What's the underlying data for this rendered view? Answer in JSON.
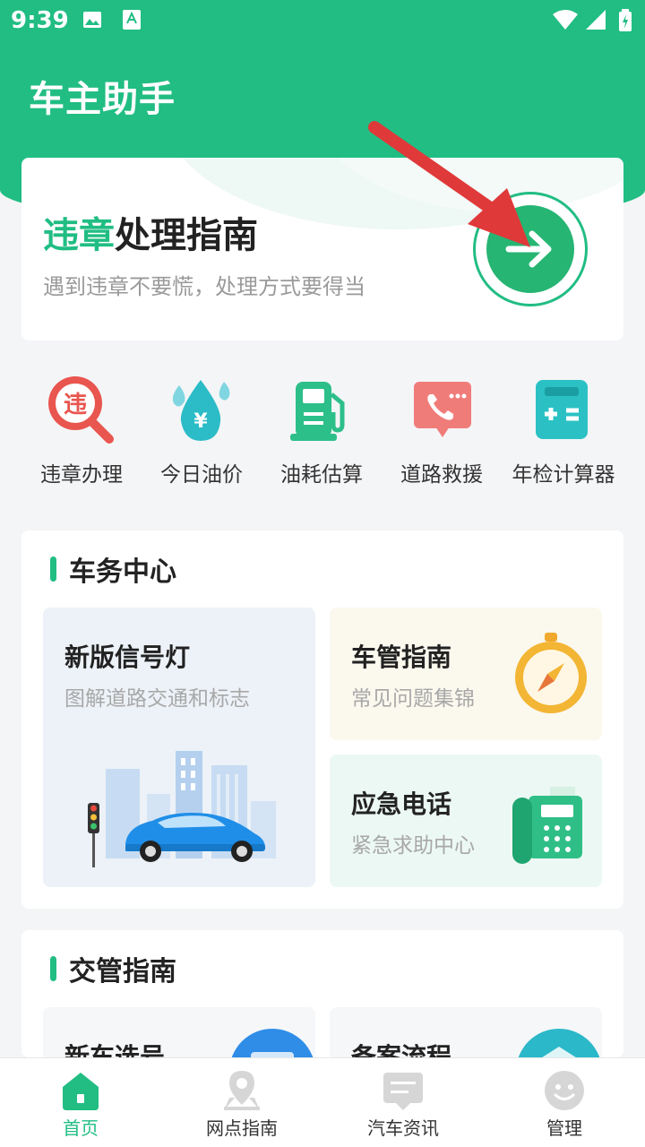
{
  "status_bar": {
    "time": "9:39"
  },
  "app": {
    "title": "车主助手"
  },
  "hero": {
    "title_accent": "违章",
    "title_rest": "处理指南",
    "subtitle": "遇到违章不要慌，处理方式要得当"
  },
  "quick_actions": [
    {
      "label": "违章办理",
      "icon": "violation-search-icon"
    },
    {
      "label": "今日油价",
      "icon": "oil-price-drop-icon"
    },
    {
      "label": "油耗估算",
      "icon": "fuel-pump-icon"
    },
    {
      "label": "道路救援",
      "icon": "phone-chat-icon"
    },
    {
      "label": "年检计算器",
      "icon": "calculator-icon"
    }
  ],
  "vehicle_center": {
    "title": "车务中心",
    "tiles": [
      {
        "title": "新版信号灯",
        "subtitle": "图解道路交通和标志",
        "icon": "car-city-illustration"
      },
      {
        "title": "车管指南",
        "subtitle": "常见问题集锦",
        "icon": "compass-icon"
      },
      {
        "title": "应急电话",
        "subtitle": "紧急求助中心",
        "icon": "telephone-icon"
      }
    ]
  },
  "traffic_guide": {
    "title": "交管指南",
    "tiles": [
      {
        "title": "新车选号"
      },
      {
        "title": "备案流程"
      }
    ]
  },
  "tab_bar": {
    "active": 0,
    "tabs": [
      {
        "label": "首页",
        "icon": "home-icon"
      },
      {
        "label": "网点指南",
        "icon": "location-pin-icon"
      },
      {
        "label": "汽车资讯",
        "icon": "news-icon"
      },
      {
        "label": "管理",
        "icon": "smiley-icon"
      }
    ]
  },
  "colors": {
    "brand": "#21bd83",
    "accent_red": "#e0393a"
  }
}
